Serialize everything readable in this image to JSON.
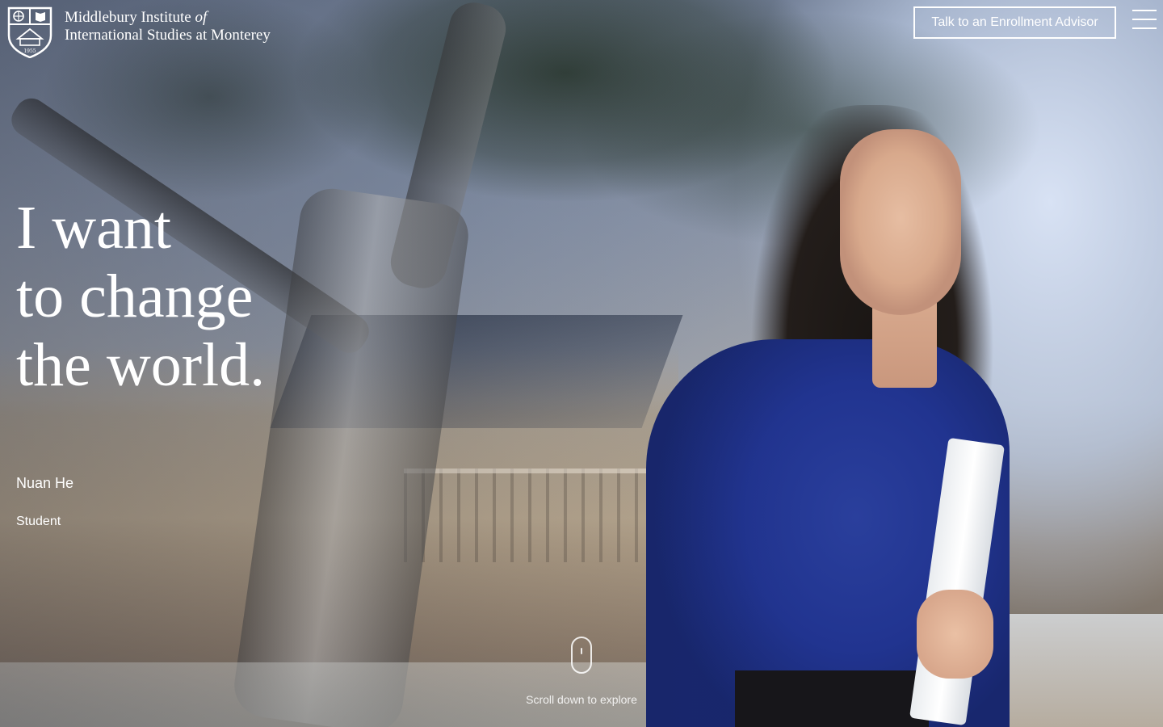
{
  "header": {
    "logo_line1": "Middlebury Institute",
    "logo_line1_italic": "of",
    "logo_line2": "International Studies at Monterey",
    "crest_year": "1955",
    "advisor_button": "Talk to an Enrollment Advisor",
    "menu_icon": "hamburger-menu-icon"
  },
  "hero": {
    "headline": [
      "I want",
      "to change",
      "the world."
    ],
    "person_name": "Nuan He",
    "person_role": "Student"
  },
  "scroll": {
    "label": "Scroll down to explore",
    "icon": "mouse-icon"
  },
  "colors": {
    "text": "#ffffff",
    "shirt_blue": "#213490"
  }
}
